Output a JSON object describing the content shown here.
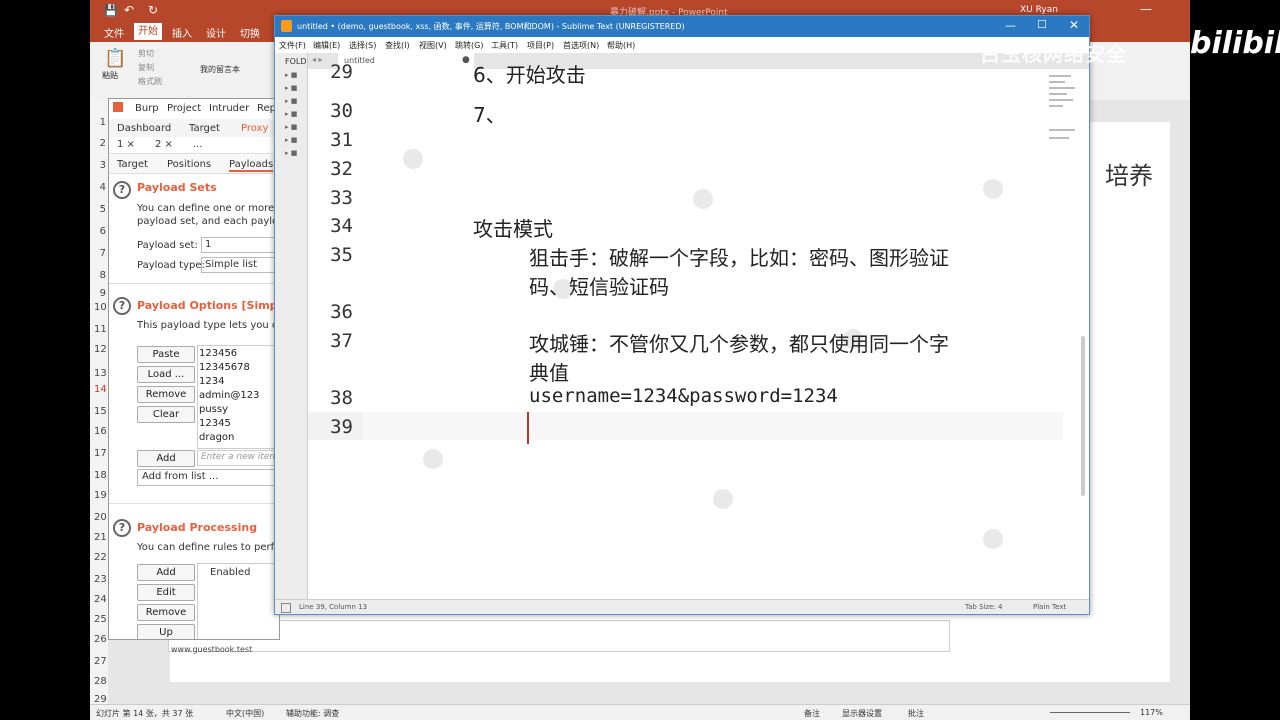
{
  "ppt": {
    "title": "暴力破解.pptx  -  PowerPoint",
    "user": "XU Ryan",
    "tabs": [
      "文件",
      "开始",
      "插入",
      "设计",
      "切换"
    ],
    "paste_label": "粘贴",
    "small_buttons": [
      "剪切",
      "复制",
      "格式刷"
    ],
    "placeholder_text": "我的留言本",
    "slide_fragment": "培养",
    "line_numbers": [
      "1",
      "2",
      "3",
      "4",
      "5",
      "6",
      "7",
      "8",
      "9",
      "10",
      "11",
      "12",
      "13",
      "14",
      "15",
      "16",
      "17",
      "18",
      "19",
      "20",
      "21",
      "22",
      "23",
      "24",
      "25",
      "26",
      "27",
      "28",
      "29"
    ],
    "status": {
      "slide_count": "幻灯片 第 14 张，共 37 张",
      "language": "中文(中国)",
      "accessibility": "辅助功能: 调查",
      "notes": "备注",
      "display_settings": "显示器设置",
      "comments": "批注",
      "zoom": "117%"
    },
    "address": "www.guestbook.test"
  },
  "burp": {
    "menu": [
      "Burp",
      "Project",
      "Intruder",
      "Rep"
    ],
    "tabs": [
      "Dashboard",
      "Target",
      "Proxy"
    ],
    "subtabs_numbers": [
      "1 ×",
      "2 ×",
      "..."
    ],
    "subtabs": [
      "Target",
      "Positions",
      "Payloads"
    ],
    "payload_sets": {
      "heading": "Payload Sets",
      "desc1": "You can define one or more pa",
      "desc2": "payload set, and each payload",
      "set_label": "Payload set:",
      "set_value": "1",
      "type_label": "Payload type:",
      "type_value": "Simple list"
    },
    "payload_options": {
      "heading": "Payload Options [Simple",
      "desc": "This payload type lets you conf",
      "buttons": [
        "Paste",
        "Load ...",
        "Remove",
        "Clear"
      ],
      "items": [
        "123456",
        "12345678",
        "1234",
        "admin@123",
        "pussy",
        "12345",
        "dragon"
      ],
      "add_button": "Add",
      "add_placeholder": "Enter a new item",
      "add_from_list": "Add from list ..."
    },
    "payload_processing": {
      "heading": "Payload Processing",
      "desc": "You can define rules to perfor",
      "buttons": [
        "Add",
        "Edit",
        "Remove",
        "Up"
      ],
      "col_enabled": "Enabled"
    }
  },
  "sublime": {
    "title": "untitled • (demo, guestbook, xss, 函数, 事件, 运算符, BOM和DOM) - Sublime Text (UNREGISTERED)",
    "menu": [
      "文件(F)",
      "编辑(E)",
      "选择(S)",
      "查找(I)",
      "视图(V)",
      "跳转(G)",
      "工具(T)",
      "项目(P)",
      "首选项(N)",
      "帮助(H)"
    ],
    "sidebar_label": "FOLD",
    "tab_label": "untitled",
    "lines": [
      {
        "num": "29",
        "text": "6、开始攻击"
      },
      {
        "num": "30",
        "text": "7、"
      },
      {
        "num": "31",
        "text": ""
      },
      {
        "num": "32",
        "text": ""
      },
      {
        "num": "33",
        "text": ""
      },
      {
        "num": "34",
        "text": "攻击模式"
      },
      {
        "num": "35",
        "text": "狙击手：破解一个字段，比如：密码、图形验证"
      },
      {
        "num": "",
        "text": "码、短信验证码"
      },
      {
        "num": "36",
        "text": ""
      },
      {
        "num": "37",
        "text": "攻城锤：不管你又几个参数，都只使用同一个字"
      },
      {
        "num": "",
        "text": "典值"
      },
      {
        "num": "38",
        "text": "username=1234&password=1234"
      },
      {
        "num": "39",
        "text": ""
      }
    ],
    "status_left": "Line 39, Column 13",
    "status_tab": "Tab Size: 4",
    "status_syntax": "Plain Text"
  },
  "overlay": {
    "channel_text": "白玉核网络安全",
    "logo": "bilibili"
  }
}
